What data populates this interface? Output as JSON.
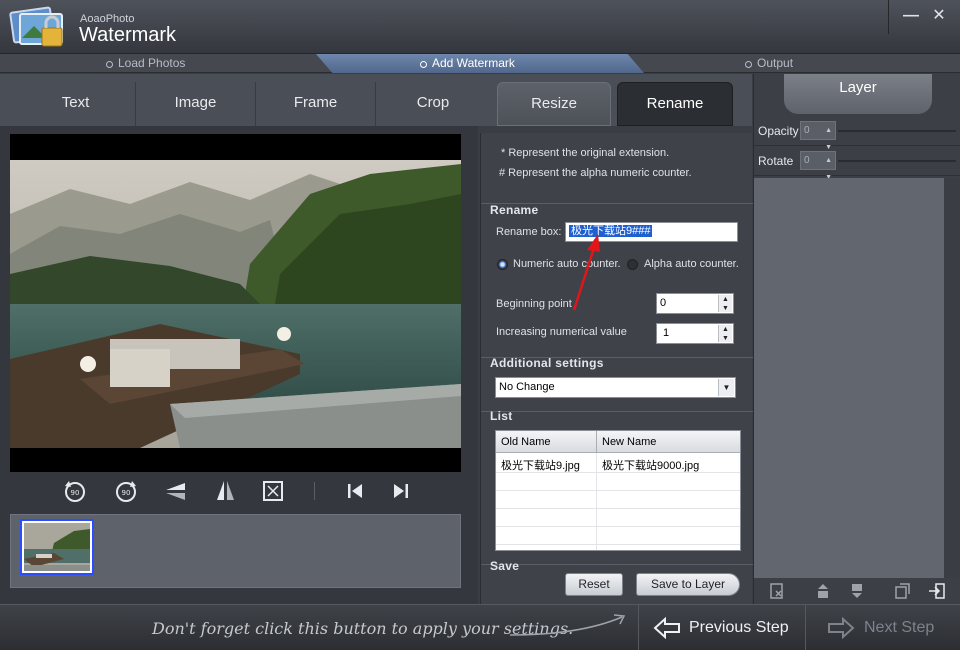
{
  "app": {
    "brand_small": "AoaoPhoto",
    "brand_big": "Watermark"
  },
  "window": {
    "minimize": "—",
    "close": "✕"
  },
  "steps": [
    {
      "label": "Load Photos"
    },
    {
      "label": "Add Watermark",
      "active": true
    },
    {
      "label": "Output"
    }
  ],
  "tabs": [
    {
      "label": "Text"
    },
    {
      "label": "Image"
    },
    {
      "label": "Frame"
    },
    {
      "label": "Crop"
    },
    {
      "label": "Resize"
    },
    {
      "label": "Rename",
      "active": true
    }
  ],
  "rename": {
    "note1": "* Represent the original extension.",
    "note2": "# Represent the alpha numeric counter.",
    "section_title": "Rename",
    "rename_box_label": "Rename box:",
    "rename_box_value": "极光下载站9###",
    "numeric_label": "Numeric auto counter.",
    "alpha_label": "Alpha auto counter.",
    "numeric_selected": true,
    "beginning_label": "Beginning point",
    "beginning_value": "0",
    "increasing_label": "Increasing numerical value",
    "increasing_value": "1"
  },
  "additional": {
    "section_title": "Additional settings",
    "dropdown_value": "No Change"
  },
  "list": {
    "section_title": "List",
    "headers": [
      "Old Name",
      "New Name"
    ],
    "rows": [
      {
        "old": "极光下载站9.jpg",
        "new": "极光下载站9000.jpg"
      }
    ]
  },
  "save": {
    "section_title": "Save",
    "reset_label": "Reset",
    "save_layer_label": "Save to Layer"
  },
  "layer": {
    "title": "Layer",
    "opacity_label": "Opacity",
    "opacity_value": "0",
    "rotate_label": "Rotate",
    "rotate_value": "0"
  },
  "bottom": {
    "hint": "Don't forget click this button to apply your settings.",
    "previous_label": "Previous Step",
    "next_label": "Next Step"
  },
  "colors": {
    "accent": "#5a73a0",
    "selection": "#1f5fd0",
    "annotation_arrow": "#e0161b"
  }
}
